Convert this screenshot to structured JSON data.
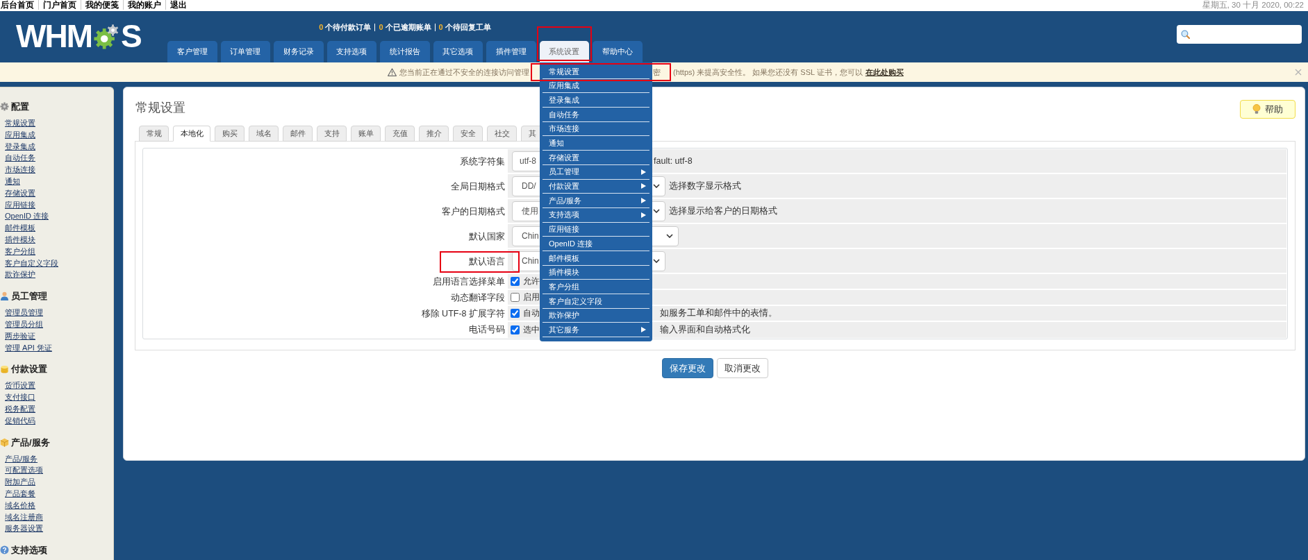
{
  "top_bar": {
    "links": [
      "后台首页",
      "门户首页",
      "我的便笺",
      "我的账户",
      "退出"
    ],
    "datetime": "星期五, 30 十月 2020, 00:22"
  },
  "header": {
    "logo": {
      "left": "WHM",
      "right": "S"
    },
    "stats": [
      {
        "count": "0",
        "label": "个待付款订单"
      },
      {
        "count": "0",
        "label": "个已逾期账单"
      },
      {
        "count": "0",
        "label": "个待回复工单"
      }
    ],
    "nav_tabs": [
      {
        "label": "客户管理",
        "selected": false,
        "highlighted": false
      },
      {
        "label": "订单管理",
        "selected": false,
        "highlighted": false
      },
      {
        "label": "财务记录",
        "selected": false,
        "highlighted": false
      },
      {
        "label": "支持选项",
        "selected": false,
        "highlighted": false
      },
      {
        "label": "统计报告",
        "selected": false,
        "highlighted": false
      },
      {
        "label": "其它选项",
        "selected": false,
        "highlighted": false
      },
      {
        "label": "插件管理",
        "selected": false,
        "highlighted": false
      },
      {
        "label": "系统设置",
        "selected": true,
        "highlighted": true
      },
      {
        "label": "帮助中心",
        "selected": false,
        "highlighted": false
      }
    ]
  },
  "warning": {
    "text_left": "您当前正在通过不安全的连接访问管理",
    "text_after_menu": "密",
    "text_right": "(https) 来提高安全性。 如果您还没有 SSL 证书，您可以",
    "link": "在此处购买"
  },
  "menu": {
    "items": [
      {
        "label": "常规设置",
        "submenu": false,
        "highlighted": true
      },
      {
        "label": "应用集成",
        "submenu": false,
        "highlighted": false
      },
      {
        "label": "登录集成",
        "submenu": false,
        "highlighted": false
      },
      {
        "label": "自动任务",
        "submenu": false,
        "highlighted": false
      },
      {
        "label": "市场连接",
        "submenu": false,
        "highlighted": false
      },
      {
        "label": "通知",
        "submenu": false,
        "highlighted": false
      },
      {
        "label": "存储设置",
        "submenu": false,
        "highlighted": false
      },
      {
        "label": "员工管理",
        "submenu": true,
        "highlighted": false
      },
      {
        "label": "付款设置",
        "submenu": true,
        "highlighted": false
      },
      {
        "label": "产品/服务",
        "submenu": true,
        "highlighted": false
      },
      {
        "label": "支持选项",
        "submenu": true,
        "highlighted": false
      },
      {
        "label": "应用链接",
        "submenu": false,
        "highlighted": false
      },
      {
        "label": "OpenID 连接",
        "submenu": false,
        "highlighted": false
      },
      {
        "label": "邮件模板",
        "submenu": false,
        "highlighted": false
      },
      {
        "label": "插件模块",
        "submenu": false,
        "highlighted": false
      },
      {
        "label": "客户分组",
        "submenu": false,
        "highlighted": false
      },
      {
        "label": "客户自定义字段",
        "submenu": false,
        "highlighted": false
      },
      {
        "label": "欺诈保护",
        "submenu": false,
        "highlighted": false
      },
      {
        "label": "其它服务",
        "submenu": true,
        "highlighted": false
      }
    ]
  },
  "sidebar": {
    "sections": [
      {
        "kind": "config",
        "title": "配置",
        "items": [
          "常规设置",
          "应用集成",
          "登录集成",
          "自动任务",
          "市场连接",
          "通知",
          "存储设置",
          "应用链接",
          "OpenID 连接",
          "邮件模板",
          "插件模块",
          "客户分组",
          "客户自定义字段",
          "欺诈保护"
        ]
      },
      {
        "kind": "staff",
        "title": "员工管理",
        "items": [
          "管理员管理",
          "管理员分组",
          "两步验证",
          "管理 API 凭证"
        ]
      },
      {
        "kind": "payment",
        "title": "付款设置",
        "items": [
          "货币设置",
          "支付接口",
          "税务配置",
          "促销代码"
        ]
      },
      {
        "kind": "products",
        "title": "产品/服务",
        "items": [
          "产品/服务",
          "可配置选项",
          "附加产品",
          "产品套餐",
          "域名价格",
          "域名注册商",
          "服务器设置"
        ]
      },
      {
        "kind": "support",
        "title": "支持选项"
      }
    ]
  },
  "page": {
    "title": "常规设置",
    "help_button": "帮助",
    "tabs": [
      {
        "label": "常规",
        "selected": false
      },
      {
        "label": "本地化",
        "selected": true
      },
      {
        "label": "购买",
        "selected": false
      },
      {
        "label": "域名",
        "selected": false
      },
      {
        "label": "邮件",
        "selected": false
      },
      {
        "label": "支持",
        "selected": false
      },
      {
        "label": "账单",
        "selected": false
      },
      {
        "label": "充值",
        "selected": false
      },
      {
        "label": "推介",
        "selected": false
      },
      {
        "label": "安全",
        "selected": false
      },
      {
        "label": "社交",
        "selected": false
      },
      {
        "label": "其",
        "selected": false
      }
    ],
    "rows": [
      {
        "kind": "input",
        "label": "系统字符集",
        "value": "utf-8",
        "note": "fault: utf-8",
        "highlighted": false
      },
      {
        "kind": "select",
        "label": "全局日期格式",
        "value": "DD/",
        "note": "选择数字显示格式",
        "highlighted": false
      },
      {
        "kind": "select",
        "label": "客户的日期格式",
        "value": "使用",
        "note": "选择显示给客户的日期格式",
        "highlighted": false
      },
      {
        "kind": "select",
        "label": "默认国家",
        "value": "Chin",
        "highlighted": false
      },
      {
        "kind": "select",
        "label": "默认语言",
        "value": "Chin",
        "highlighted": true
      },
      {
        "kind": "checkbox",
        "label": "启用语言选择菜单",
        "checked": true,
        "text": "允许",
        "highlighted": false
      },
      {
        "kind": "checkbox",
        "label": "动态翻译字段",
        "checked": false,
        "text": "启用",
        "highlighted": false
      },
      {
        "kind": "checkbox",
        "label": "移除 UTF-8 扩展字符",
        "checked": true,
        "text": "自动",
        "note": "如服务工单和邮件中的表情。",
        "highlighted": false
      },
      {
        "kind": "checkbox",
        "label": "电话号码",
        "checked": true,
        "text": "选中",
        "note": "输入界面和自动格式化",
        "highlighted": false
      }
    ],
    "buttons": [
      {
        "kind": "primary",
        "label": "保存更改"
      },
      {
        "kind": "default",
        "label": "取消更改"
      }
    ]
  }
}
